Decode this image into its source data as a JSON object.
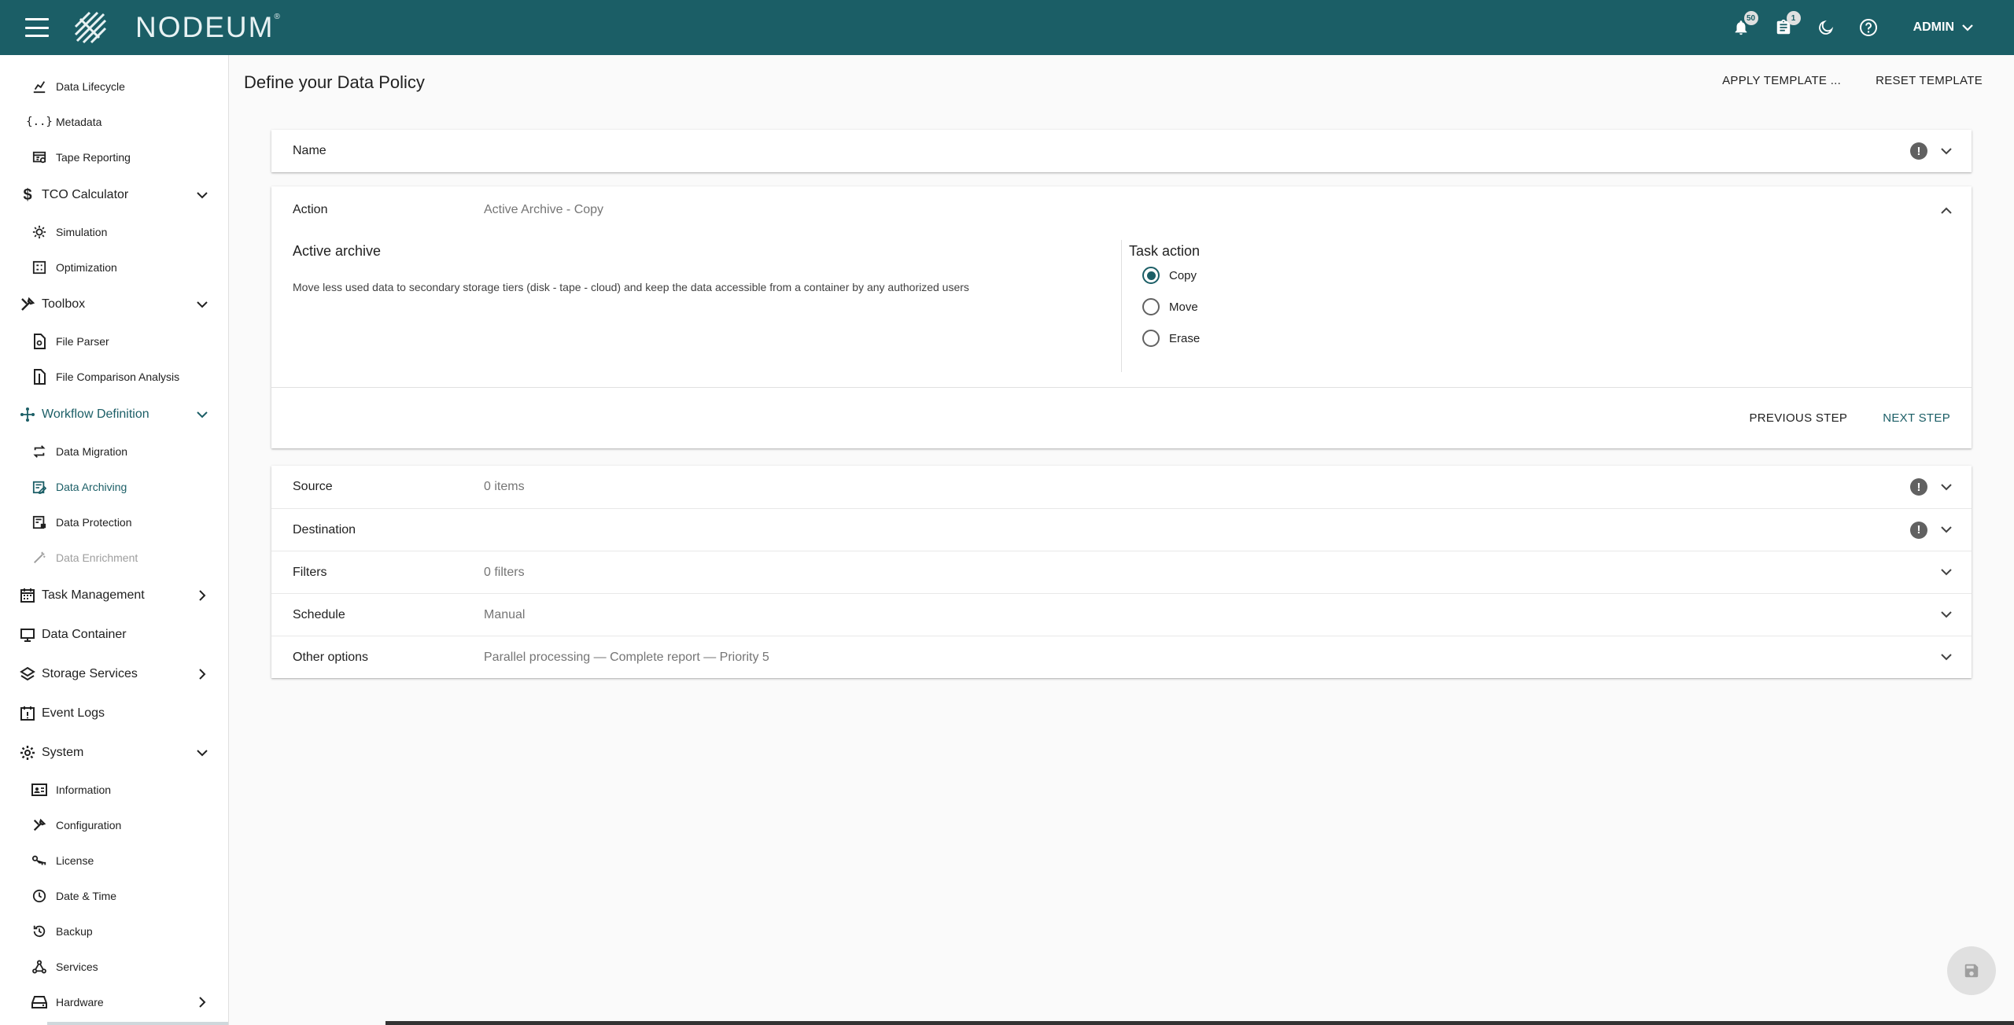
{
  "topbar": {
    "brand": "NODEUM",
    "brand_mark": "®",
    "notifications_count": "50",
    "tasks_count": "1",
    "user": "ADMIN"
  },
  "sidebar": {
    "items": [
      {
        "label": "Data Lifecycle",
        "icon": "chart-icon"
      },
      {
        "label": "Metadata",
        "icon": "braces-icon"
      },
      {
        "label": "Tape Reporting",
        "icon": "tape-report-icon"
      },
      {
        "label": "TCO Calculator",
        "icon": "dollar-icon"
      },
      {
        "label": "Simulation",
        "icon": "sun-icon"
      },
      {
        "label": "Optimization",
        "icon": "grid-icon"
      },
      {
        "label": "Toolbox",
        "icon": "tools-icon"
      },
      {
        "label": "File Parser",
        "icon": "file-icon"
      },
      {
        "label": "File Comparison Analysis",
        "icon": "file-compare-icon"
      },
      {
        "label": "Workflow Definition",
        "icon": "workflow-icon"
      },
      {
        "label": "Data Migration",
        "icon": "repeat-icon"
      },
      {
        "label": "Data Archiving",
        "icon": "archive-icon"
      },
      {
        "label": "Data Protection",
        "icon": "protection-icon"
      },
      {
        "label": "Data Enrichment",
        "icon": "wand-icon"
      },
      {
        "label": "Task Management",
        "icon": "calendar-icon"
      },
      {
        "label": "Data Container",
        "icon": "monitor-icon"
      },
      {
        "label": "Storage Services",
        "icon": "layers-icon"
      },
      {
        "label": "Event Logs",
        "icon": "event-icon"
      },
      {
        "label": "System",
        "icon": "gear-icon"
      },
      {
        "label": "Information",
        "icon": "id-card-icon"
      },
      {
        "label": "Configuration",
        "icon": "tools-icon"
      },
      {
        "label": "License",
        "icon": "key-icon"
      },
      {
        "label": "Date & Time",
        "icon": "clock-icon"
      },
      {
        "label": "Backup",
        "icon": "backup-icon"
      },
      {
        "label": "Services",
        "icon": "network-icon"
      },
      {
        "label": "Hardware",
        "icon": "hardware-icon"
      }
    ]
  },
  "main": {
    "title": "Define your Data Policy",
    "apply_template": "APPLY TEMPLATE ...",
    "reset_template": "RESET TEMPLATE",
    "name_section": {
      "title": "Name"
    },
    "action_section": {
      "title": "Action",
      "summary": "Active Archive - Copy",
      "heading": "Active archive",
      "description": "Move less used data to secondary storage tiers (disk - tape - cloud) and keep the data accessible from a container by any authorized users",
      "task_action_label": "Task action",
      "options": [
        "Copy",
        "Move",
        "Erase"
      ],
      "selected": "Copy",
      "previous": "PREVIOUS STEP",
      "next": "NEXT STEP"
    },
    "sections": [
      {
        "title": "Source",
        "summary": "0 items"
      },
      {
        "title": "Destination",
        "summary": ""
      },
      {
        "title": "Filters",
        "summary": "0 filters"
      },
      {
        "title": "Schedule",
        "summary": "Manual"
      },
      {
        "title": "Other options",
        "summary": "Parallel processing — Complete report — Priority 5"
      }
    ],
    "warning_glyph": "!"
  },
  "colors": {
    "primary": "#1b5e66",
    "topbar": "#1b5e66"
  }
}
